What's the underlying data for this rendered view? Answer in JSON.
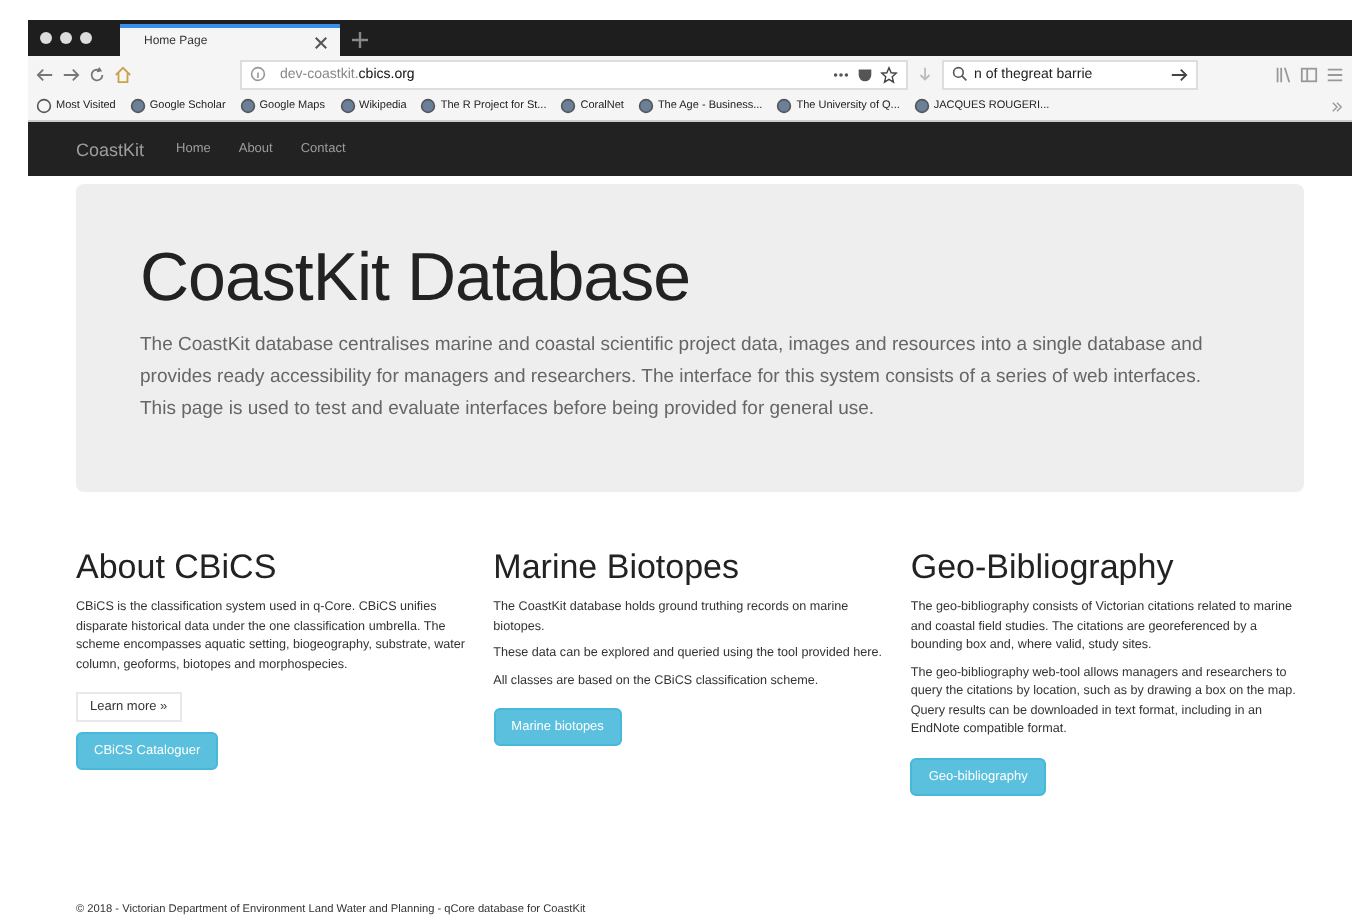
{
  "browser": {
    "tab": {
      "title": "Home Page",
      "selected": true
    },
    "url": {
      "prefix": "dev-coastkit.",
      "domain": "cbics.org"
    },
    "search": {
      "value": "n of thegreat barrie"
    },
    "bookmarks": [
      "Most Visited",
      "Google Scholar",
      "Google Maps",
      "Wikipedia",
      "The R Project for St...",
      "CoralNet",
      "The Age - Business...",
      "The University of Q...",
      "JACQUES ROUGERI..."
    ]
  },
  "navbar": {
    "brand": "CoastKit",
    "links": [
      "Home",
      "About",
      "Contact"
    ]
  },
  "jumbotron": {
    "title": "CoastKit Database",
    "text": "The CoastKit database centralises marine and coastal scientific project data, images and resources into a single database and provides ready accessibility for managers and researchers. The interface for this system consists of a series of web interfaces. This page is used to test and evaluate interfaces before being provided for general use."
  },
  "columns": [
    {
      "heading": "About CBiCS",
      "paragraphs": [
        "CBiCS is the classification system used in q-Core. CBiCS unifies disparate historical data under the one classification umbrella. The scheme encompasses aquatic setting, biogeography, substrate, water column, geoforms, biotopes and morphospecies."
      ],
      "link": "Learn more »",
      "button": "CBiCS Cataloguer"
    },
    {
      "heading": "Marine Biotopes",
      "paragraphs": [
        "The CoastKit database holds ground truthing records on marine biotopes.",
        "These data can be explored and queried using the tool provided here.",
        "All classes are based on the CBiCS classification scheme."
      ],
      "button": "Marine biotopes"
    },
    {
      "heading": "Geo-Bibliography",
      "paragraphs": [
        "The geo-bibliography consists of Victorian citations related to marine and coastal field studies. The citations are georeferenced by a bounding box and, where valid, study sites.",
        "The geo-bibliography web-tool allows managers and researchers to query the citations by location, such as by drawing a box on the map. Query results can be downloaded in text format, including in an EndNote compatible format."
      ],
      "button": "Geo-bibliography"
    }
  ],
  "footer": "© 2018 - Victorian Department of Environment Land Water and Planning - qCore database for CoastKit"
}
